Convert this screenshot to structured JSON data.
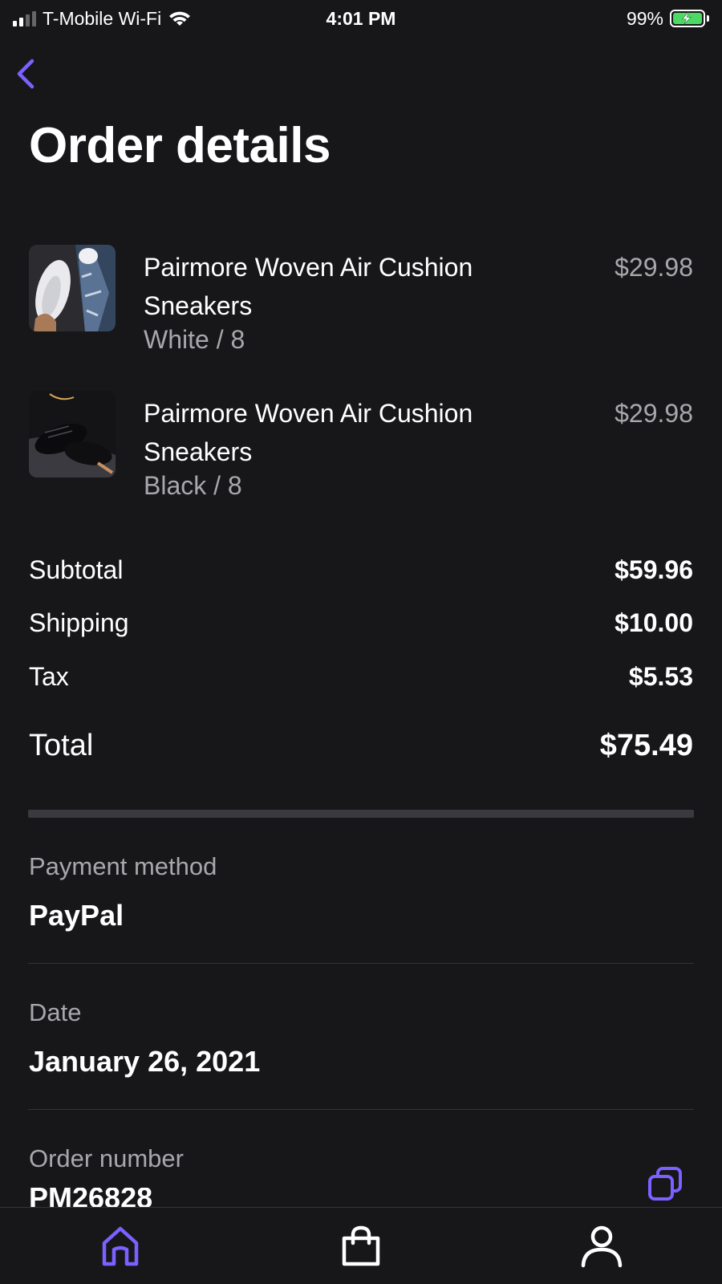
{
  "status_bar": {
    "carrier": "T-Mobile Wi-Fi",
    "time": "4:01 PM",
    "battery": "99%"
  },
  "page": {
    "title": "Order details"
  },
  "items": [
    {
      "name": "Pairmore Woven Air Cushion Sneakers",
      "variant": "White / 8",
      "price": "$29.98"
    },
    {
      "name": "Pairmore Woven Air Cushion Sneakers",
      "variant": "Black / 8",
      "price": "$29.98"
    }
  ],
  "summary": {
    "subtotal_label": "Subtotal",
    "subtotal": "$59.96",
    "shipping_label": "Shipping",
    "shipping": "$10.00",
    "tax_label": "Tax",
    "tax": "$5.53",
    "total_label": "Total",
    "total": "$75.49"
  },
  "payment": {
    "label": "Payment method",
    "value": "PayPal"
  },
  "date": {
    "label": "Date",
    "value": "January 26, 2021"
  },
  "order": {
    "label": "Order number",
    "value": "PM26828"
  },
  "colors": {
    "accent": "#7b61ff",
    "background": "#17171a",
    "muted_text": "#a8a8ac"
  },
  "tabs": [
    "home-icon",
    "shopping-bag-icon",
    "profile-icon"
  ]
}
